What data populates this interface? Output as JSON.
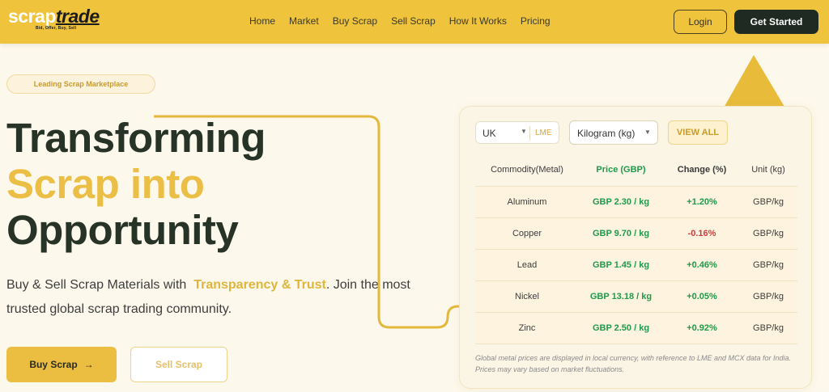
{
  "brand": {
    "name_part1": "scrap",
    "name_part2": "trade",
    "tagline": "Bid, Offer, Buy, Sell"
  },
  "nav": {
    "items": [
      "Home",
      "Market",
      "Buy Scrap",
      "Sell Scrap",
      "How It Works",
      "Pricing"
    ],
    "login_label": "Login",
    "get_started_label": "Get Started"
  },
  "hero": {
    "badge": "Leading Scrap Marketplace",
    "headline_line1": "Transforming",
    "headline_line2": "Scrap into",
    "headline_line3": "Opportunity",
    "lead_prefix": "Buy & Sell Scrap Materials with",
    "lead_accent": "Transparency & Trust",
    "lead_suffix": ". Join the most trusted global scrap trading community.",
    "buy_label": "Buy Scrap",
    "buy_arrow": "→",
    "sell_label": "Sell Scrap"
  },
  "prices": {
    "country": "UK",
    "exchange": "LME",
    "unit_select": "Kilogram (kg)",
    "view_all_label": "VIEW ALL",
    "caret": "▼",
    "columns": [
      "Commodity(Metal)",
      "Price (GBP)",
      "Change (%)",
      "Unit (kg)"
    ],
    "rows": [
      {
        "metal": "Aluminum",
        "price": "GBP 2.30 / kg",
        "change": "+1.20%",
        "direction": "up",
        "unit": "GBP/kg"
      },
      {
        "metal": "Copper",
        "price": "GBP 9.70 / kg",
        "change": "-0.16%",
        "direction": "down",
        "unit": "GBP/kg"
      },
      {
        "metal": "Lead",
        "price": "GBP 1.45 / kg",
        "change": "+0.46%",
        "direction": "up",
        "unit": "GBP/kg"
      },
      {
        "metal": "Nickel",
        "price": "GBP 13.18 / kg",
        "change": "+0.05%",
        "direction": "up",
        "unit": "GBP/kg"
      },
      {
        "metal": "Zinc",
        "price": "GBP 2.50 / kg",
        "change": "+0.92%",
        "direction": "up",
        "unit": "GBP/kg"
      }
    ],
    "footnote": "Global metal prices are displayed in local currency, with reference to LME and MCX data for India. Prices may vary based on market fluctuations."
  },
  "colors": {
    "header_bg": "#f0c33c",
    "accent_gold": "#ebbe45",
    "dark_green": "#263326",
    "positive": "#1f9a4b",
    "negative": "#d33a3a"
  }
}
